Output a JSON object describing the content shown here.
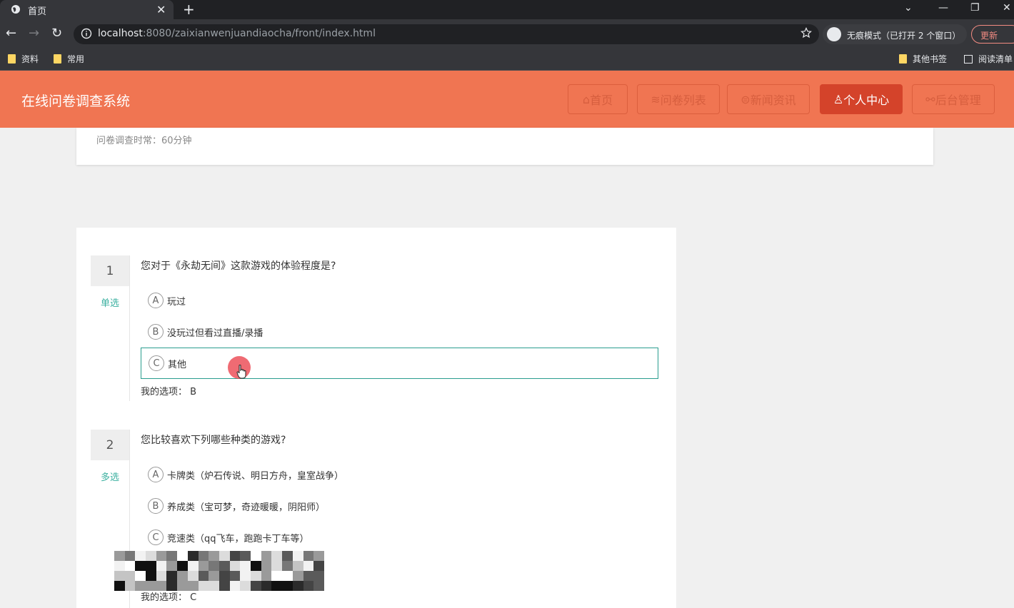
{
  "browser": {
    "tab_title": "首页",
    "url_host": "localhost",
    "url_path": ":8080/zaixianwenjuandiaocha/front/index.html",
    "incognito_label": "无痕模式（已打开 2 个窗口）",
    "update_label": "更新",
    "bookmarks": [
      "资料",
      "常用"
    ],
    "other_bookmarks": "其他书签",
    "reading_list": "阅读清单"
  },
  "site": {
    "title": "在线问卷调查系统",
    "nav": [
      {
        "label": "首页",
        "icon": "home-icon"
      },
      {
        "label": "问卷列表",
        "icon": "layers-icon"
      },
      {
        "label": "新闻资讯",
        "icon": "news-icon"
      },
      {
        "label": "个人中心",
        "icon": "user-icon"
      },
      {
        "label": "后台管理",
        "icon": "link-icon"
      }
    ]
  },
  "survey": {
    "duration": "问卷调查时常：60分钟"
  },
  "questions": [
    {
      "number": "1",
      "type": "单选",
      "text": "您对于《永劫无间》这款游戏的体验程度是?",
      "options": [
        {
          "letter": "A",
          "text": "玩过"
        },
        {
          "letter": "B",
          "text": "没玩过但看过直播/录播"
        },
        {
          "letter": "C",
          "text": "其他"
        }
      ],
      "my_choice_label": "我的选项：",
      "my_choice": "B"
    },
    {
      "number": "2",
      "type": "多选",
      "text": "您比较喜欢下列哪些种类的游戏?",
      "options": [
        {
          "letter": "A",
          "text": "卡牌类（炉石传说、明日方舟，皇室战争）"
        },
        {
          "letter": "B",
          "text": "养成类（宝可梦，奇迹暖暖，阴阳师）"
        },
        {
          "letter": "C",
          "text": "竞速类（qq飞车，跑跑卡丁车等）"
        }
      ],
      "my_choice_label": "我的选项：",
      "my_choice": "C"
    }
  ],
  "colors": {
    "header": "#f07552",
    "active_nav": "#d4432a",
    "accent_teal": "#3bb0a0"
  }
}
